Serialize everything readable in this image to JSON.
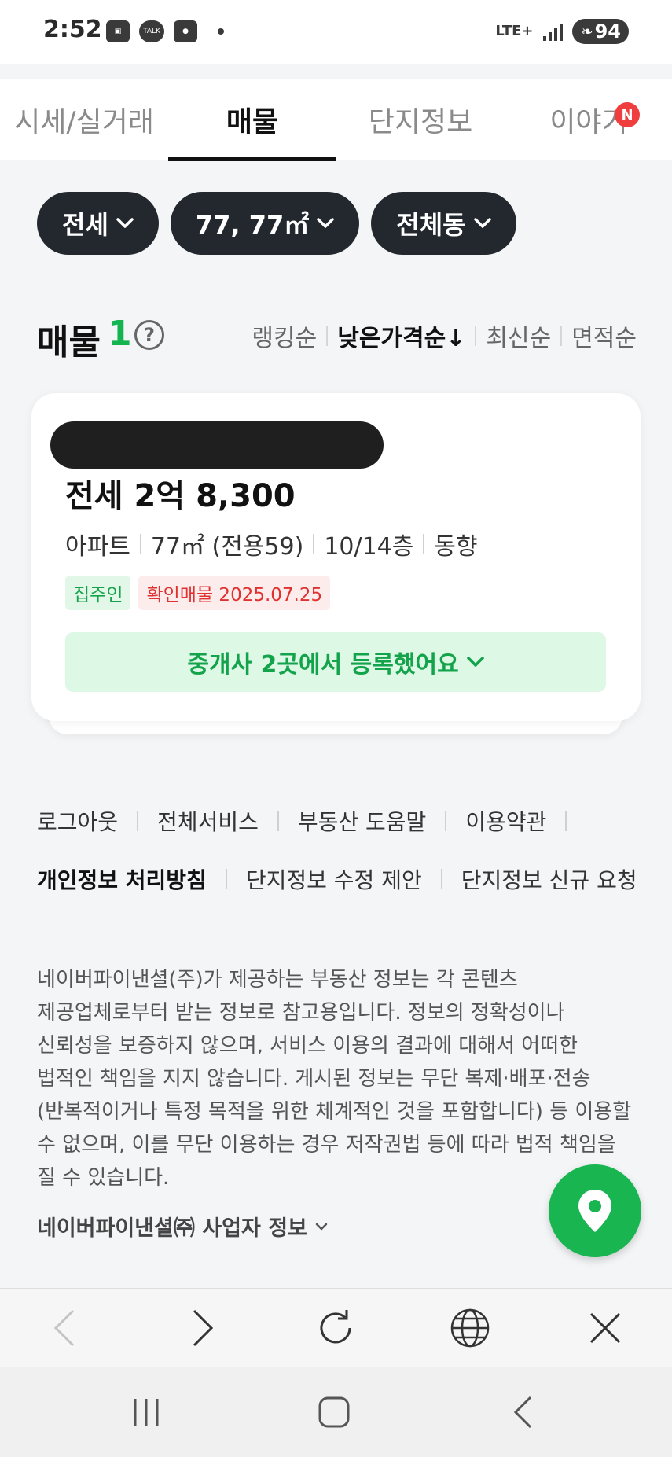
{
  "status_bar": {
    "time": "2:52",
    "notification_icons": [
      "image-icon",
      "kakaotalk-icon",
      "car-icon"
    ],
    "talk_label": "TALK",
    "network": "LTE+",
    "battery": "94"
  },
  "tabs": [
    {
      "label": "시세/실거래",
      "active": false
    },
    {
      "label": "매물",
      "active": true
    },
    {
      "label": "단지정보",
      "active": false
    },
    {
      "label": "이야기",
      "active": false,
      "badge": "N"
    }
  ],
  "filters": [
    {
      "label": "전세"
    },
    {
      "label": "77, 77㎡"
    },
    {
      "label": "전체동"
    }
  ],
  "listing_header": {
    "title": "매물",
    "count": "1",
    "help_symbol": "?",
    "sort_options": [
      {
        "label": "랭킹순",
        "active": false
      },
      {
        "label": "낮은가격순↓",
        "active": true
      },
      {
        "label": "최신순",
        "active": false
      },
      {
        "label": "면적순",
        "active": false
      }
    ]
  },
  "listing": {
    "price": "전세 2억 8,300",
    "specs": [
      "아파트",
      "77㎡ (전용59)",
      "10/14층",
      "동향"
    ],
    "tag_owner": "집주인",
    "tag_verified": "확인매물 2025.07.25",
    "agent_button": "중개사 2곳에서 등록했어요"
  },
  "footer": {
    "links_row1": [
      "로그아웃",
      "전체서비스",
      "부동산 도움말",
      "이용약관"
    ],
    "links_row2": [
      "개인정보 처리방침",
      "단지정보 수정 제안",
      "단지정보 신규 요청"
    ],
    "disclaimer": "네이버파이낸셜(주)가 제공하는 부동산 정보는 각 콘텐츠 제공업체로부터 받는 정보로 참고용입니다. 정보의 정확성이나 신뢰성을 보증하지 않으며, 서비스 이용의 결과에 대해서 어떠한 법적인 책임을 지지 않습니다. 게시된 정보는 무단 복제·배포·전송(반복적이거나 특정 목적을 위한 체계적인 것을 포함합니다) 등 이용할 수 없으며, 이를 무단 이용하는 경우 저작권법 등에 따라 법적 책임을 질 수 있습니다.",
    "business_info": "네이버파이낸셜㈜ 사업자 정보"
  },
  "colors": {
    "accent_green": "#18b550",
    "chip_dark": "#23272e",
    "badge_red": "#f03e3e"
  }
}
